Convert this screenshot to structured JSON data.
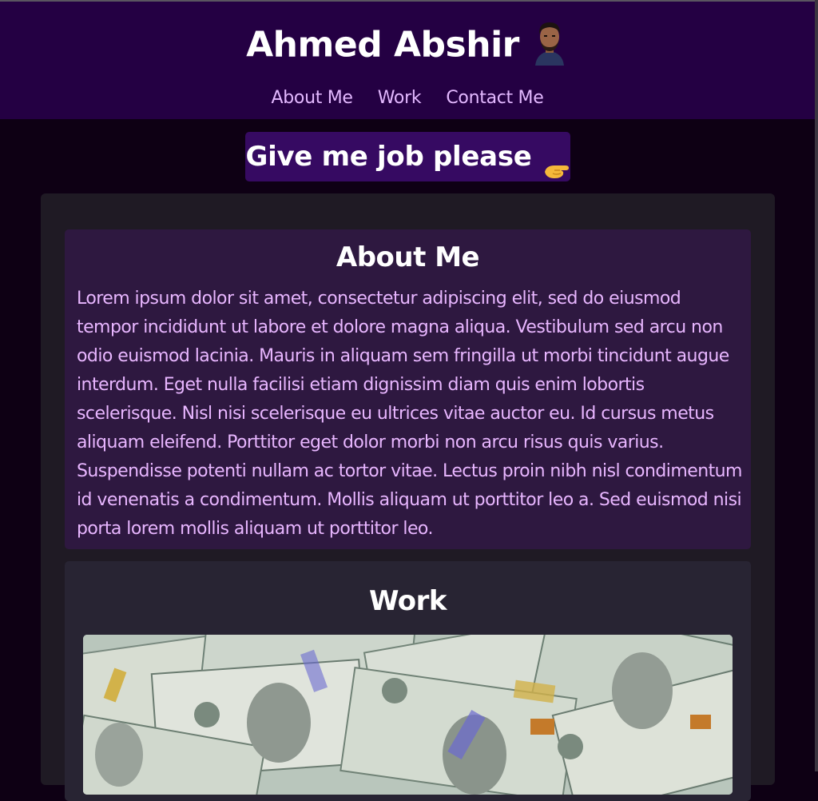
{
  "header": {
    "title": "Ahmed Abshir",
    "avatar_icon": "avatar-photo",
    "nav": [
      {
        "label": "About Me"
      },
      {
        "label": "Work"
      },
      {
        "label": "Contact Me"
      }
    ]
  },
  "cta": {
    "label": "Give me job please",
    "icon": "handshake-hand-icon"
  },
  "about": {
    "heading": "About Me",
    "body": "Lorem ipsum dolor sit amet, consectetur adipiscing elit, sed do eiusmod tempor incididunt ut labore et dolore magna aliqua. Vestibulum sed arcu non odio euismod lacinia. Mauris in aliquam sem fringilla ut morbi tincidunt augue interdum. Eget nulla facilisi etiam dignissim diam quis enim lobortis scelerisque. Nisl nisi scelerisque eu ultrices vitae auctor eu. Id cursus metus aliquam eleifend. Porttitor eget dolor morbi non arcu risus quis varius. Suspendisse potenti nullam ac tortor vitae. Lectus proin nibh nisl condimentum id venenatis a condimentum. Mollis aliquam ut porttitor leo a. Sed euismod nisi porta lorem mollis aliquam ut porttitor leo."
  },
  "work": {
    "heading": "Work",
    "image": "money-photo"
  },
  "colors": {
    "page_bg": "#0e0014",
    "header_bg": "#240043",
    "nav_link": "#e3b8ff",
    "cta_bg": "#360a62",
    "container_bg": "#1f1a24",
    "about_bg": "#2e1840",
    "about_text": "#e8b6ff",
    "work_bg": "#282433"
  }
}
